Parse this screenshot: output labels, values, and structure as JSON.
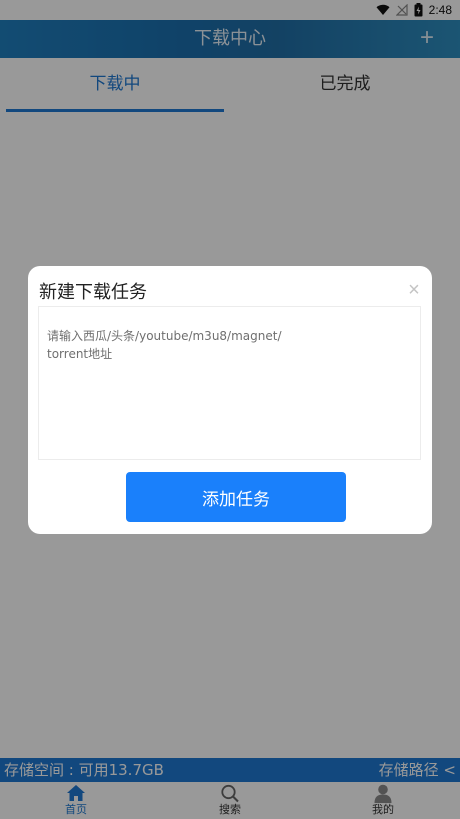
{
  "status_bar": {
    "time": "2:48"
  },
  "header": {
    "title": "下载中心",
    "add_label": "+"
  },
  "tabs": [
    {
      "label": "下载中",
      "active": true
    },
    {
      "label": "已完成",
      "active": false
    }
  ],
  "storage": {
    "available": "存储空间 : 可用13.7GB",
    "path_label": "存储路径 <"
  },
  "bottom_nav": [
    {
      "label": "首页",
      "icon": "home-icon",
      "active": true
    },
    {
      "label": "搜索",
      "icon": "search-icon",
      "active": false
    },
    {
      "label": "我的",
      "icon": "person-icon",
      "active": false
    }
  ],
  "dialog": {
    "title": "新建下载任务",
    "close_label": "×",
    "input_placeholder": "请输入西瓜/头条/youtube/m3u8/magnet/\ntorrent地址",
    "input_value": "",
    "submit_label": "添加任务"
  },
  "colors": {
    "accent": "#1e78d2",
    "button": "#1a80fb",
    "header": "#1f7fbf"
  }
}
